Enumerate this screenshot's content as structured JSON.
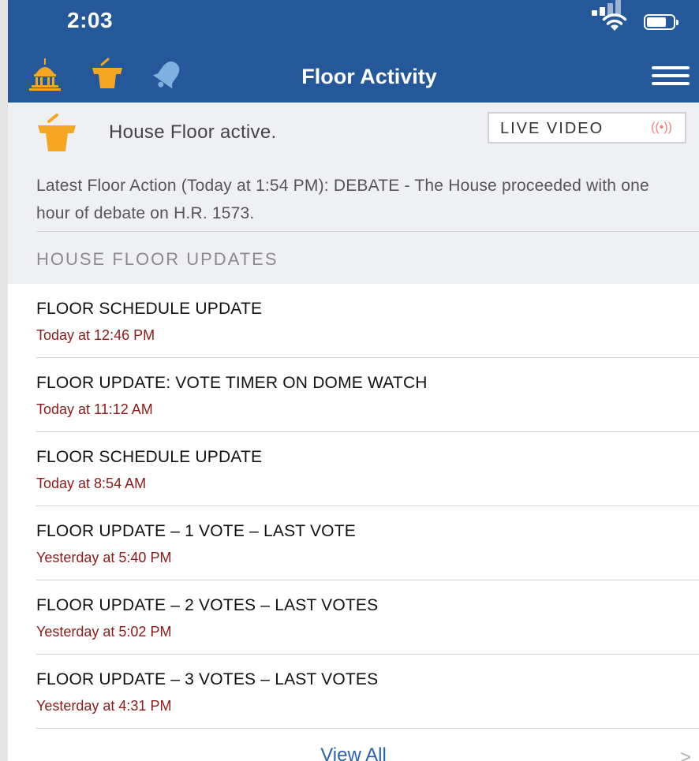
{
  "status_bar": {
    "time": "2:03"
  },
  "nav": {
    "title": "Floor Activity",
    "icons": [
      "capitol-icon",
      "podium-icon",
      "bell-icon",
      "menu-icon"
    ]
  },
  "floor_status": {
    "text": "House Floor active.",
    "live_video_label": "LIVE VIDEO",
    "live_icon": "((•))",
    "latest_action": "Latest Floor Action (Today at 1:54 PM): DEBATE - The House proceeded with one hour of debate on H.R. 1573."
  },
  "section_header": "HOUSE FLOOR UPDATES",
  "updates": [
    {
      "title": "FLOOR SCHEDULE UPDATE",
      "time": "Today at 12:46 PM"
    },
    {
      "title": "FLOOR UPDATE: VOTE TIMER ON DOME WATCH",
      "time": "Today at 11:12 AM"
    },
    {
      "title": "FLOOR SCHEDULE UPDATE",
      "time": "Today at 8:54 AM"
    },
    {
      "title": "FLOOR UPDATE – 1 VOTE – LAST VOTE",
      "time": "Yesterday at 5:40 PM"
    },
    {
      "title": "FLOOR UPDATE – 2 VOTES – LAST VOTES",
      "time": "Yesterday at 5:02 PM"
    },
    {
      "title": "FLOOR UPDATE – 3 VOTES – LAST VOTES",
      "time": "Yesterday at 4:31 PM"
    }
  ],
  "view_all_label": "View All",
  "chevron": ">",
  "colors": {
    "header_bg": "#24589a",
    "accent_orange": "#f5a623",
    "time_red": "#8b1a1a",
    "link_blue": "#2a63a8"
  }
}
